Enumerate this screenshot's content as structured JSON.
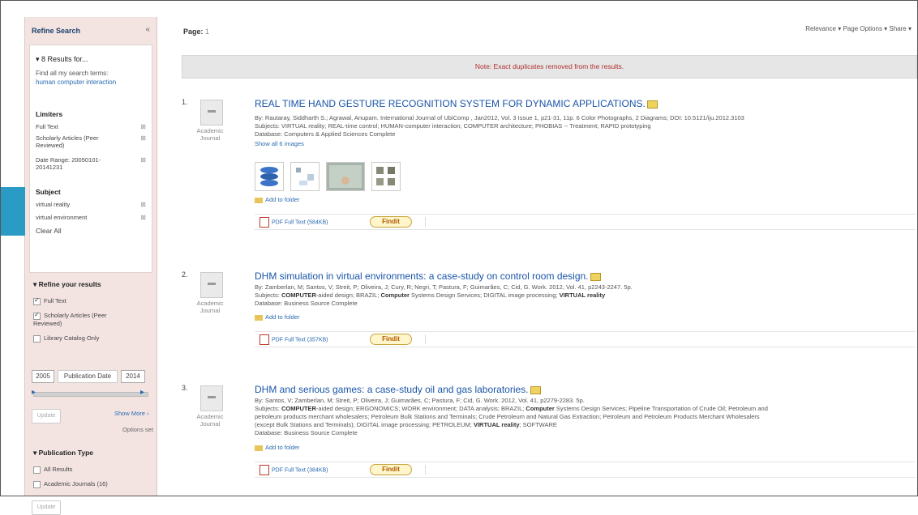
{
  "sidebar": {
    "heading": "Refine Search",
    "collapse": "«",
    "results_for": "▾ 8 Results for...",
    "find_all": "Find all my search terms:",
    "search_terms": "human computer interaction",
    "limiters_heading": "Limiters",
    "limiters": [
      {
        "label": "Full Text"
      },
      {
        "label": "Scholarly Articles (Peer Reviewed)"
      },
      {
        "label": "Date Range: 20050101-20141231"
      }
    ],
    "subject_heading": "Subject",
    "subjects": [
      {
        "label": "virtual reality"
      },
      {
        "label": "virtual environment"
      }
    ],
    "clear_all": "Clear All",
    "refine_heading": "▾ Refine your results",
    "refine_options": [
      {
        "label": "Full Text",
        "checked": true
      },
      {
        "label": "Scholarly Articles (Peer Reviewed)",
        "checked": true
      },
      {
        "label": "Library Catalog Only",
        "checked": false
      }
    ],
    "date_from": "2005",
    "date_label": "Publication Date",
    "date_to": "2014",
    "update_button": "Update",
    "show_more": "Show More ›",
    "options_set": "Options set",
    "pubtype_heading": "▾ Publication Type",
    "pubtypes": [
      {
        "label": "All Results",
        "checked": false
      },
      {
        "label": "Academic Journals (16)",
        "checked": false
      }
    ],
    "update_button_2": "Update"
  },
  "main": {
    "page_label": "Page:",
    "page_value": "1",
    "top_options": "Relevance ▾   Page Options ▾   Share ▾",
    "note": "Note: Exact duplicates removed from the results."
  },
  "results": [
    {
      "num": "1.",
      "type": "Academic Journal",
      "title": "REAL TIME HAND GESTURE RECOGNITION SYSTEM FOR DYNAMIC APPLICATIONS.",
      "byline": "By: Rautaray, Siddharth S.; Agrawal, Anupam. International Journal of UbiComp , Jan2012, Vol. 3 Issue 1, p21-31, 11p. 6 Color Photographs, 2 Diagrams; DOI: 10.5121/iju.2012.3103",
      "subjects": "Subjects: VIRTUAL reality; REAL-time control; HUMAN-computer interaction; COMPUTER architecture; PHOBIAS -- Treatment; RAPID prototyping",
      "database": "Database: Computers & Applied Sciences Complete",
      "show_images": "Show all 6 images",
      "add_folder": "Add to folder",
      "pdf": "PDF Full Text (584KB)",
      "findit": "Findit"
    },
    {
      "num": "2.",
      "type": "Academic Journal",
      "title": "DHM simulation in virtual environments: a case-study on control room design.",
      "byline": "By: Zamberlan, M; Santos, V; Streit, P; Oliveira, J; Cury, R; Negri, T; Pastura, F; Guimarães, C; Cid, G. Work. 2012, Vol. 41, p2243-2247. 5p.",
      "subjects_pre": "Subjects: ",
      "subjects_b1": "COMPUTER",
      "subjects_mid": "-aided design; BRAZIL; ",
      "subjects_b2": "Computer",
      "subjects_mid2": " Systems Design Services; DIGITAL image processing; ",
      "subjects_b3": "VIRTUAL reality",
      "database": "Database: Business Source Complete",
      "add_folder": "Add to folder",
      "pdf": "PDF Full Text (357KB)",
      "findit": "Findit"
    },
    {
      "num": "3.",
      "type": "Academic Journal",
      "title": "DHM and serious games: a case-study oil and gas laboratories.",
      "byline": "By: Santos, V; Zamberlan, M; Streit, P; Oliveira, J; Guimarães, C; Pastura, F; Cid, G. Work. 2012, Vol. 41, p2279-2283. 5p.",
      "subjects_pre": "Subjects: ",
      "subjects_b1": "COMPUTER",
      "subjects_mid": "-aided design; ERGONOMICS; WORK environment; DATA analysis; BRAZIL; ",
      "subjects_b2": "Computer",
      "subjects_mid2": " Systems Design Services; Pipeline Transportation of Crude Oil; Petroleum and",
      "line2": "petroleum products merchant wholesalers; Petroleum Bulk Stations and Terminals; Crude Petroleum and Natural Gas Extraction; Petroleum and Petroleum Products Merchant Wholesalers",
      "line3_pre": "(except Bulk Stations and Terminals); DIGITAL image processing; PETROLEUM; ",
      "line3_b": "VIRTUAL reality",
      "line3_post": "; SOFTWARE",
      "database": "Database: Business Source Complete",
      "add_folder": "Add to folder",
      "pdf": "PDF Full Text (384KB)",
      "findit": "Findit"
    }
  ],
  "colors": {
    "accent": "#2a9bc4",
    "sidebar_bg": "#f3e4e2",
    "link": "#1a55a8",
    "note": "#b03030"
  }
}
